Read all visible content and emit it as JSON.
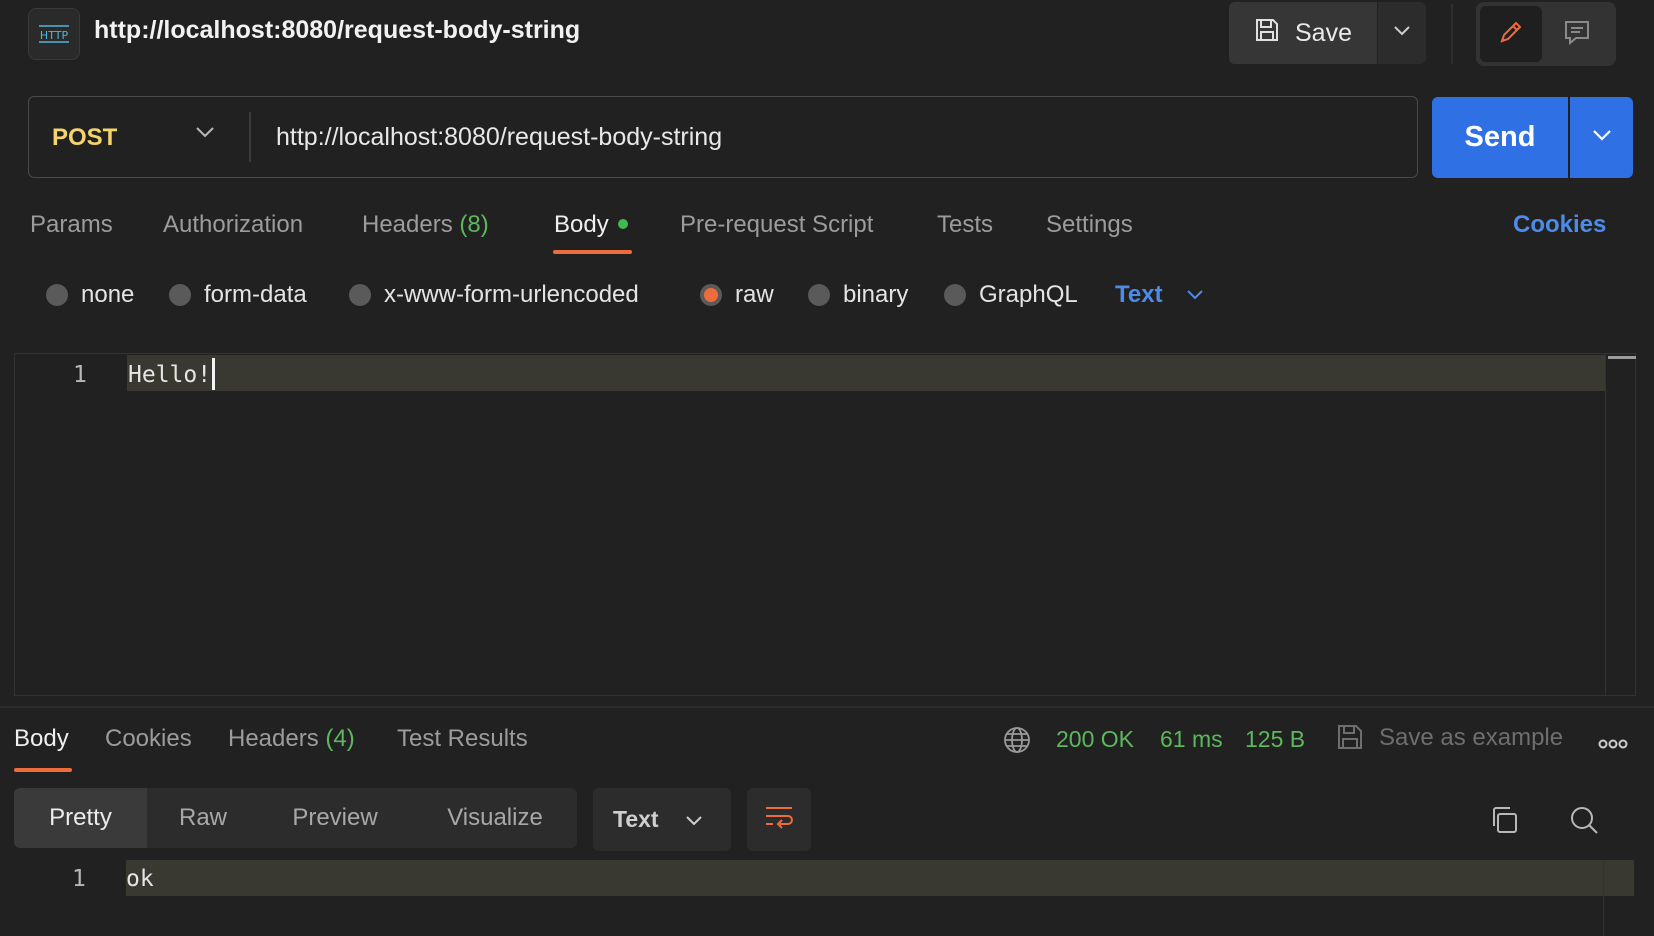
{
  "header": {
    "badge": "HTTP",
    "request_title": "http://localhost:8080/request-body-string",
    "save_label": "Save"
  },
  "request": {
    "method": "POST",
    "url": "http://localhost:8080/request-body-string",
    "send_label": "Send"
  },
  "request_tabs": {
    "params": "Params",
    "authorization": "Authorization",
    "headers": "Headers",
    "headers_count": "(8)",
    "body": "Body",
    "prerequest": "Pre-request Script",
    "tests": "Tests",
    "settings": "Settings",
    "cookies": "Cookies"
  },
  "body_types": {
    "none": "none",
    "form_data": "form-data",
    "urlencoded": "x-www-form-urlencoded",
    "raw": "raw",
    "binary": "binary",
    "graphql": "GraphQL",
    "selected": "raw",
    "format": "Text"
  },
  "editor": {
    "lines": [
      {
        "number": "1",
        "text": "Hello!"
      }
    ]
  },
  "response_tabs": {
    "body": "Body",
    "cookies": "Cookies",
    "headers": "Headers",
    "headers_count": "(4)",
    "test_results": "Test Results"
  },
  "response_status": {
    "code": "200 OK",
    "time": "61 ms",
    "size": "125 B",
    "save_example": "Save as example"
  },
  "response_view": {
    "pretty": "Pretty",
    "raw": "Raw",
    "preview": "Preview",
    "visualize": "Visualize",
    "format": "Text",
    "lines": [
      {
        "number": "1",
        "text": "ok"
      }
    ]
  },
  "colors": {
    "accent_orange": "#ee6b3c",
    "send_blue": "#2f71e5",
    "link_blue": "#4d8be8",
    "success_green": "#5cb85c",
    "method_yellow": "#f4d46b"
  }
}
